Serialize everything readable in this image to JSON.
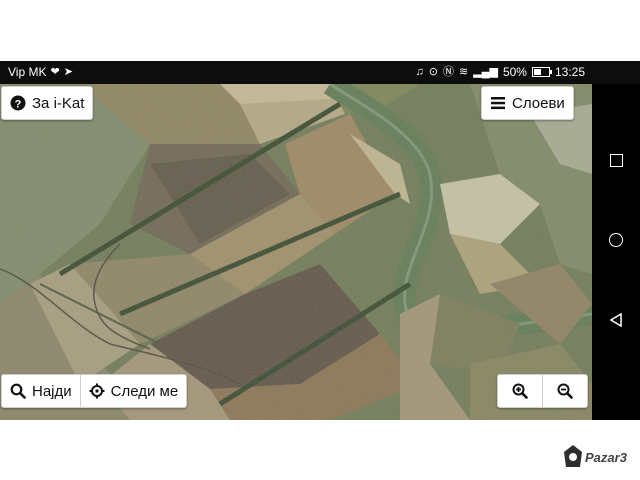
{
  "status_bar": {
    "carrier": "Vip MK",
    "battery_percent": "50%",
    "time": "13:25",
    "battery_level": 0.5,
    "icons": [
      "heart-pulse-icon",
      "arrow-icon",
      "headset-icon",
      "location-icon",
      "nfc-icon",
      "wifi-icon",
      "signal-icon",
      "battery-icon"
    ]
  },
  "toolbar": {
    "about_label": "За i-Kat",
    "layers_label": "Слоеви",
    "search_label": "Најди",
    "follow_label": "Следи ме"
  },
  "zoom": {
    "in_icon": "zoom-in-icon",
    "out_icon": "zoom-out-icon"
  },
  "nav": {
    "icons": [
      "recents-square-icon",
      "home-circle-icon",
      "back-triangle-icon"
    ]
  },
  "watermark": {
    "text": "Pazar3"
  },
  "colors": {
    "statusbar_bg": "#0d0d0d",
    "navbar_bg": "#000000",
    "map_base": "#6f7a58"
  }
}
